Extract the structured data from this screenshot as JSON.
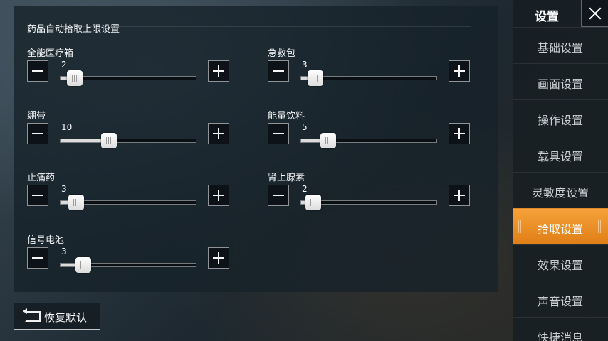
{
  "panel": {
    "title": "药品自动拾取上限设置",
    "settings": [
      {
        "label": "全能医疗箱",
        "value": "2",
        "fraction": 0.08
      },
      {
        "label": "急救包",
        "value": "3",
        "fraction": 0.08
      },
      {
        "label": "绷带",
        "value": "10",
        "fraction": 0.33
      },
      {
        "label": "能量饮料",
        "value": "5",
        "fraction": 0.17
      },
      {
        "label": "止痛药",
        "value": "3",
        "fraction": 0.09
      },
      {
        "label": "肾上腺素",
        "value": "2",
        "fraction": 0.06
      },
      {
        "label": "信号电池",
        "value": "3",
        "fraction": 0.14
      }
    ]
  },
  "restore_button": {
    "label": "恢复默认",
    "icon": "restore-icon"
  },
  "sidebar": {
    "title": "设置",
    "close_icon": "close-icon",
    "items": [
      {
        "label": "基础设置"
      },
      {
        "label": "画面设置"
      },
      {
        "label": "操作设置"
      },
      {
        "label": "载具设置"
      },
      {
        "label": "灵敏度设置"
      },
      {
        "label": "拾取设置",
        "active": true
      },
      {
        "label": "效果设置"
      },
      {
        "label": "声音设置"
      },
      {
        "label": "快捷消息"
      }
    ]
  },
  "colors": {
    "accent": "#f09a2a",
    "panel_bg": "#162129",
    "sidebar_bg": "#181f24"
  }
}
